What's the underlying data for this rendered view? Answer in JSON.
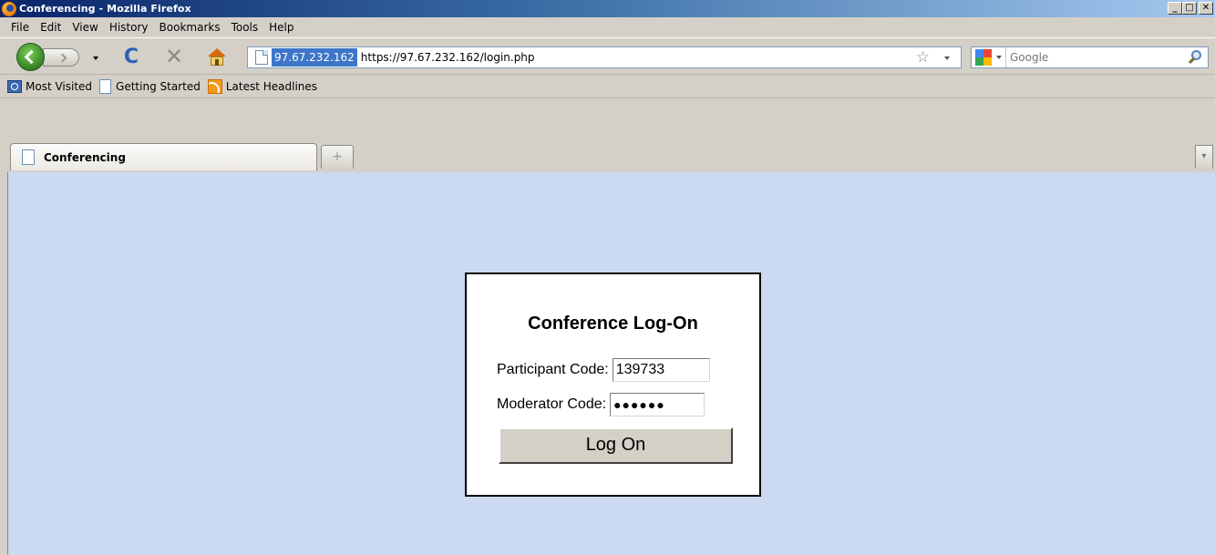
{
  "window": {
    "title": "Conferencing - Mozilla Firefox",
    "controls": [
      "_",
      "□",
      "✕"
    ]
  },
  "menu": {
    "items": [
      "File",
      "Edit",
      "View",
      "History",
      "Bookmarks",
      "Tools",
      "Help"
    ]
  },
  "navbar": {
    "identity": "97.67.232.162",
    "url": "https://97.67.232.162/login.php",
    "search_placeholder": "Google",
    "reload_glyph": "C",
    "stop_glyph": "✕",
    "star_glyph": "☆"
  },
  "bookmarks": {
    "items": [
      "Most Visited",
      "Getting Started",
      "Latest Headlines"
    ]
  },
  "tabs": {
    "active_title": "Conferencing",
    "newtab_glyph": "+",
    "list_glyph": "▾"
  },
  "login": {
    "title": "Conference Log-On",
    "participant_label": "Participant Code:",
    "participant_value": "139733",
    "moderator_label": "Moderator Code:",
    "moderator_value": "●●●●●●",
    "button_label": "Log On"
  },
  "colors": {
    "content_bg": "#cbdaf0",
    "titlebar_start": "#0a246a",
    "url_identity_bg": "#3d76c8"
  }
}
